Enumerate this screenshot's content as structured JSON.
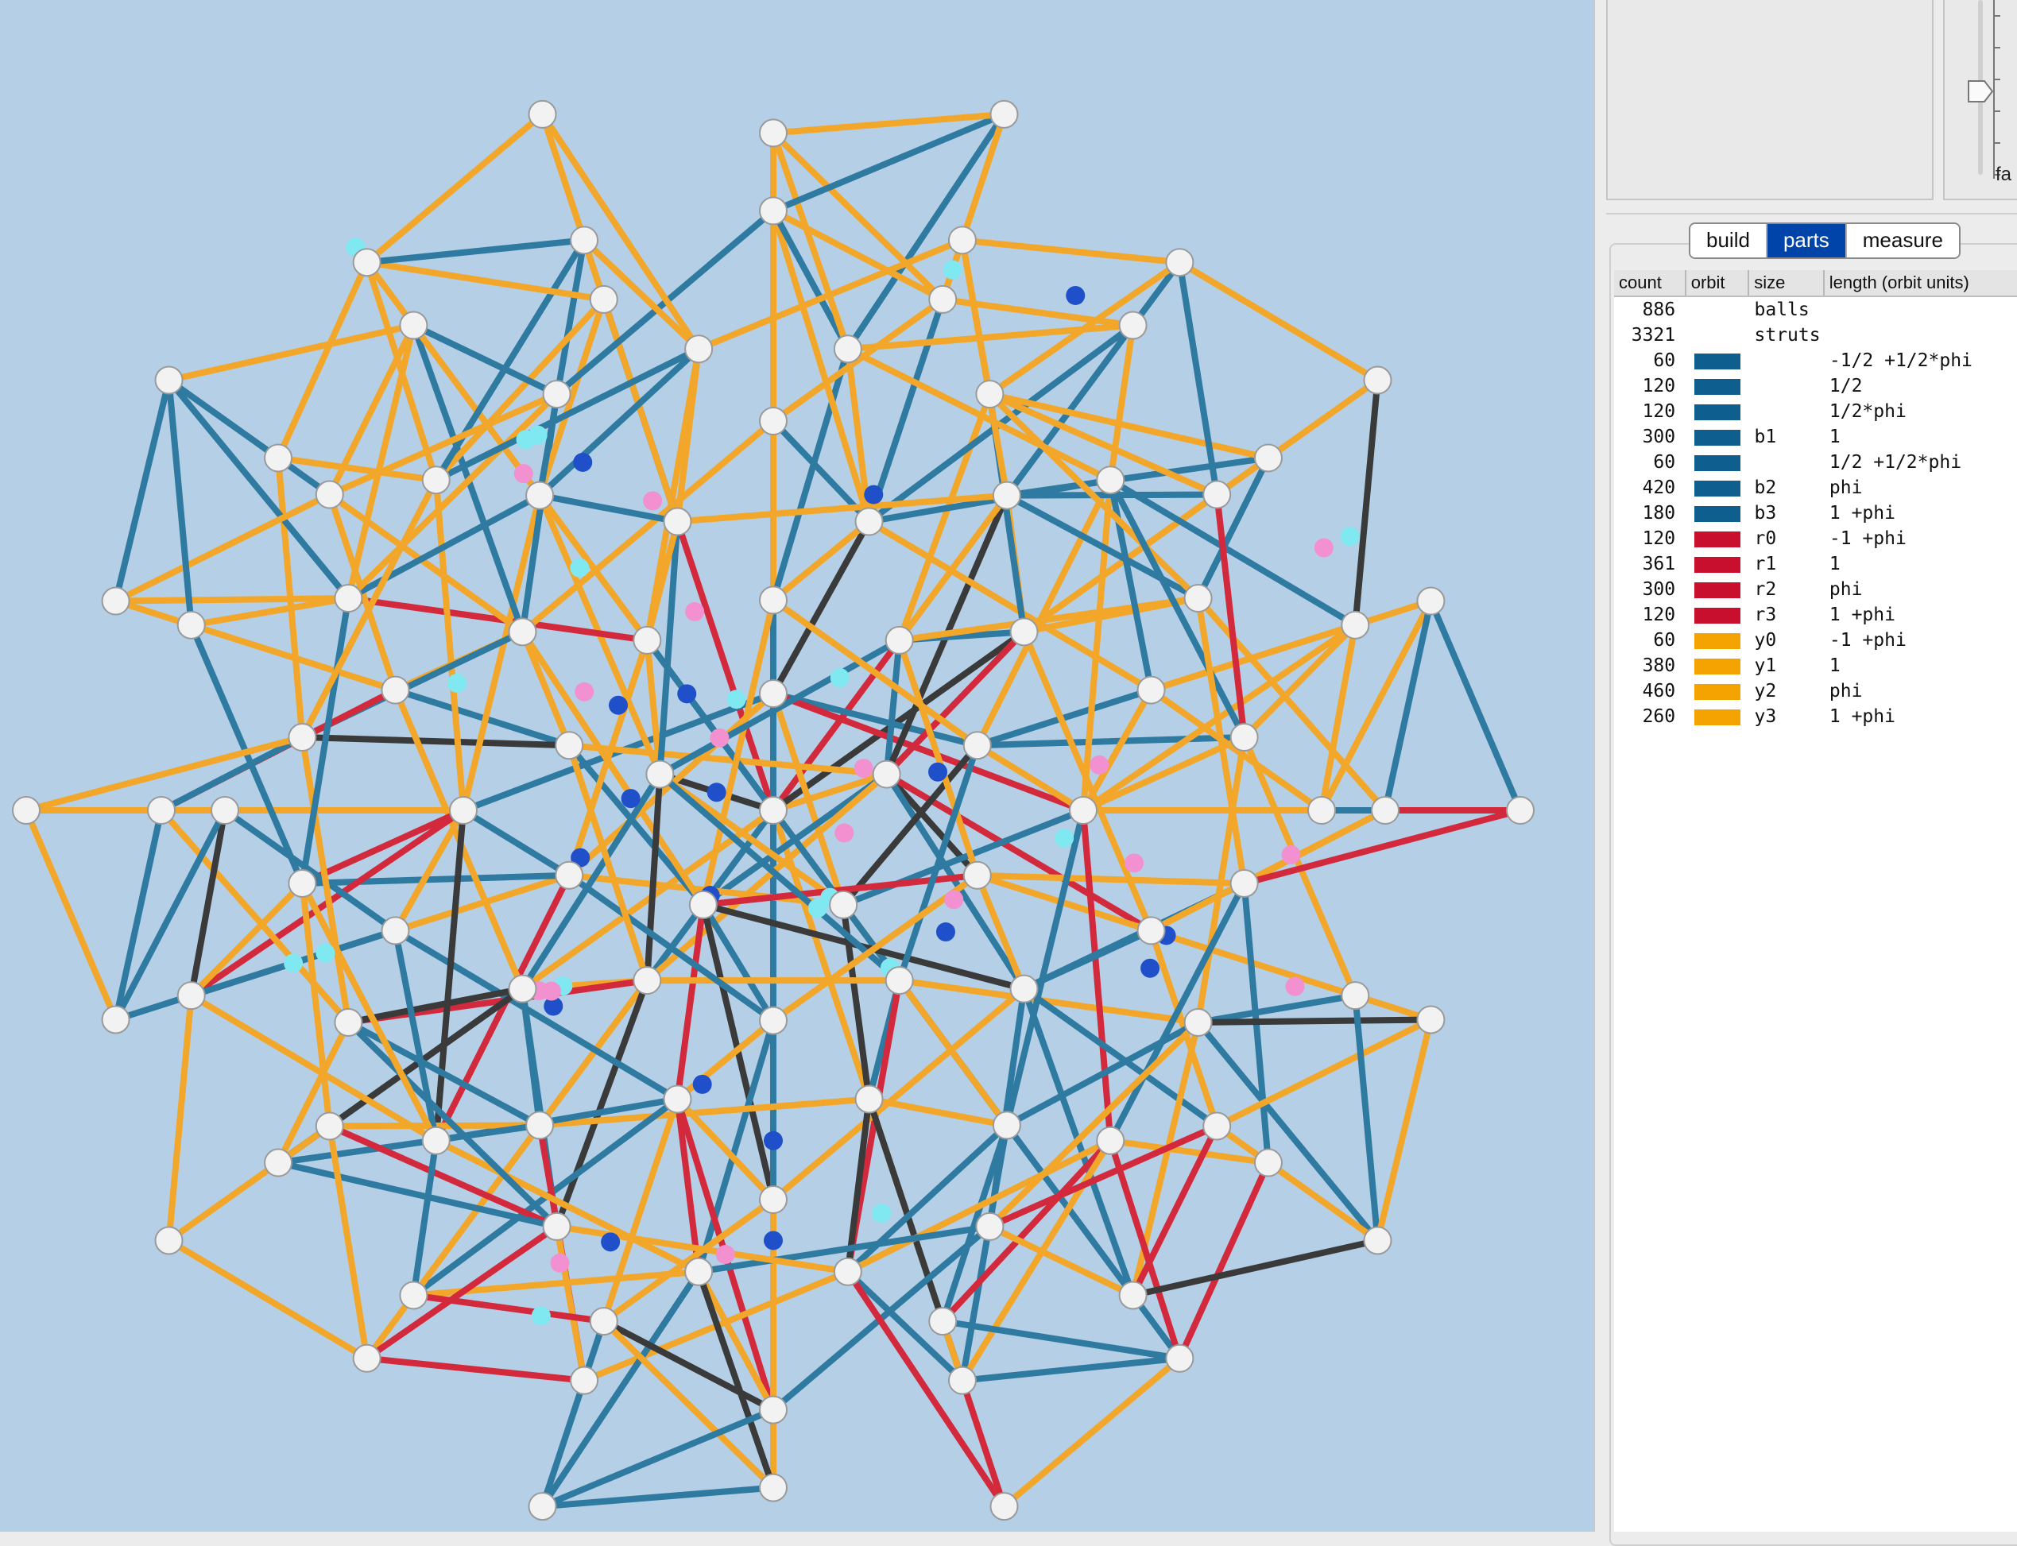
{
  "colors": {
    "background": "#b5cfe6",
    "blue": "#2f7aa0",
    "red": "#d3293d",
    "yellow": "#f2a72a",
    "dark": "#3a3a3a",
    "ball": "#f2f2f2"
  },
  "slider": {
    "label": "fa"
  },
  "tabs": [
    {
      "label": "build",
      "active": false
    },
    {
      "label": "parts",
      "active": true
    },
    {
      "label": "measure",
      "active": false
    }
  ],
  "parts_table": {
    "headers": [
      "count",
      "orbit",
      "size",
      "length (orbit units)"
    ],
    "rows": [
      {
        "count": "886",
        "orbit_color": "",
        "size": "balls",
        "length": ""
      },
      {
        "count": "3321",
        "orbit_color": "",
        "size": "struts",
        "length": ""
      },
      {
        "count": "60",
        "orbit_color": "#0e5f8e",
        "size": "",
        "length": "-1/2 +1/2*phi"
      },
      {
        "count": "120",
        "orbit_color": "#0e5f8e",
        "size": "",
        "length": "1/2"
      },
      {
        "count": "120",
        "orbit_color": "#0e5f8e",
        "size": "",
        "length": "1/2*phi"
      },
      {
        "count": "300",
        "orbit_color": "#0e5f8e",
        "size": "b1",
        "length": "1"
      },
      {
        "count": "60",
        "orbit_color": "#0e5f8e",
        "size": "",
        "length": "1/2 +1/2*phi"
      },
      {
        "count": "420",
        "orbit_color": "#0e5f8e",
        "size": "b2",
        "length": "phi"
      },
      {
        "count": "180",
        "orbit_color": "#0e5f8e",
        "size": "b3",
        "length": "1 +phi"
      },
      {
        "count": "120",
        "orbit_color": "#c8102e",
        "size": "r0",
        "length": "-1 +phi"
      },
      {
        "count": "361",
        "orbit_color": "#c8102e",
        "size": "r1",
        "length": "1"
      },
      {
        "count": "300",
        "orbit_color": "#c8102e",
        "size": "r2",
        "length": "phi"
      },
      {
        "count": "120",
        "orbit_color": "#c8102e",
        "size": "r3",
        "length": "1 +phi"
      },
      {
        "count": "60",
        "orbit_color": "#f4a300",
        "size": "y0",
        "length": "-1 +phi"
      },
      {
        "count": "380",
        "orbit_color": "#f4a300",
        "size": "y1",
        "length": "1"
      },
      {
        "count": "460",
        "orbit_color": "#f4a300",
        "size": "y2",
        "length": "phi"
      },
      {
        "count": "260",
        "orbit_color": "#f4a300",
        "size": "y3",
        "length": "1 +phi"
      }
    ]
  }
}
